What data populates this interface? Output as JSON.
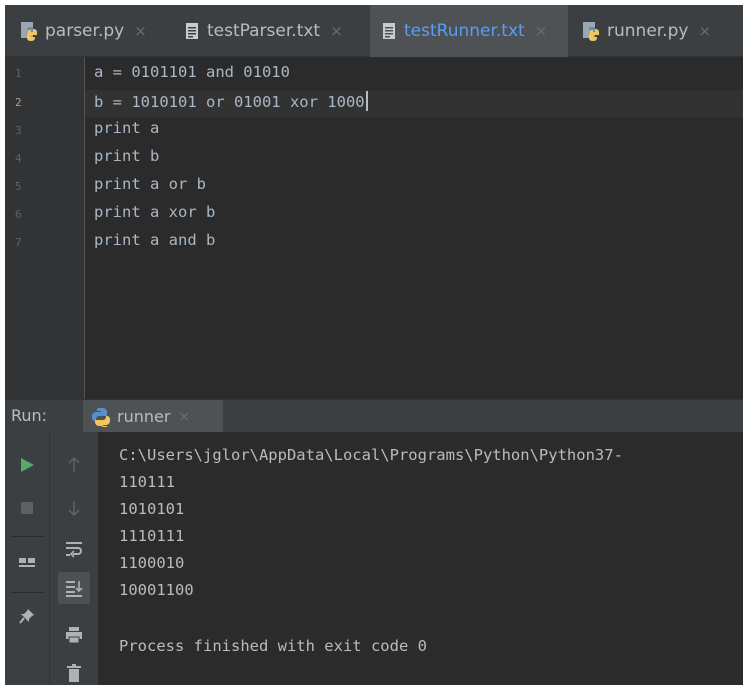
{
  "tabs": [
    {
      "label": "parser.py",
      "icon": "python-file-icon",
      "active": false
    },
    {
      "label": "testParser.txt",
      "icon": "text-file-icon",
      "active": false
    },
    {
      "label": "testRunner.txt",
      "icon": "text-file-icon",
      "active": true
    },
    {
      "label": "runner.py",
      "icon": "python-file-icon",
      "active": false
    }
  ],
  "tab_close_glyph": "×",
  "editor": {
    "line_numbers": [
      "1",
      "2",
      "3",
      "4",
      "5",
      "6",
      "7"
    ],
    "current_line": "2",
    "lines": [
      "a = 0101101 and 01010",
      "b = 1010101 or 01001 xor 1000",
      "print a",
      "print b",
      "print a or b",
      "print a xor b",
      "print a and b"
    ]
  },
  "run": {
    "label": "Run:",
    "tab_label": "runner",
    "tab_icon": "python-icon",
    "console_lines": [
      "C:\\Users\\jglor\\AppData\\Local\\Programs\\Python\\Python37-",
      "110111",
      "1010101",
      "1110111",
      "1100010",
      "10001100",
      "",
      "Process finished with exit code 0"
    ],
    "toolbar": {
      "left": [
        "run-icon",
        "stop-icon",
        "layout-icon",
        "pin-icon"
      ],
      "right": [
        "up-arrow-icon",
        "down-arrow-icon",
        "soft-wrap-icon",
        "scroll-to-end-icon",
        "print-icon",
        "trash-icon"
      ]
    }
  },
  "colors": {
    "editor_bg": "#2b2b2b",
    "panel_bg": "#3c3f41",
    "active_tab_text": "#589df6",
    "code_text": "#a9b7c6",
    "run_green": "#59a869"
  }
}
